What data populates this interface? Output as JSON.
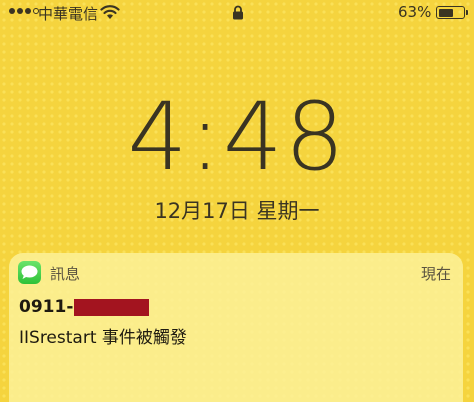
{
  "status_bar": {
    "carrier": "中華電信",
    "signal_bars_filled": 3,
    "signal_bars_total": 5,
    "battery_percent_label": "63%",
    "battery_level": 0.63,
    "icons": [
      "signal-dots-icon",
      "wifi-icon",
      "lock-icon",
      "battery-icon"
    ]
  },
  "lock_screen": {
    "time": "4:48",
    "date": "12月17日 星期一"
  },
  "notification": {
    "app_name": "訊息",
    "timestamp": "現在",
    "sender": "0911-",
    "message": "IISrestart 事件被觸發",
    "redaction_color": "#a3141f",
    "app_icon_color": "#34c759"
  },
  "colors": {
    "wallpaper": "#f5d43e",
    "text": "#3a3422"
  }
}
